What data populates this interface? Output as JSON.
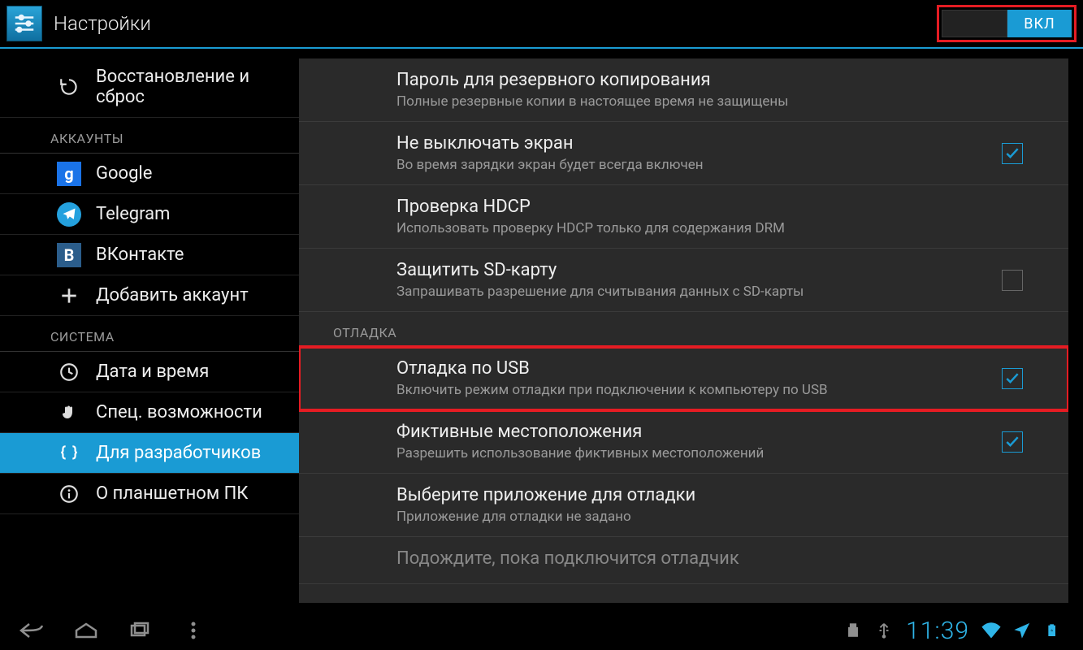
{
  "header": {
    "title": "Настройки",
    "switch_on_label": "ВКЛ"
  },
  "sidebar": {
    "items": [
      {
        "kind": "item",
        "icon": "restore",
        "label": "Восстановление и сброс"
      },
      {
        "kind": "header",
        "label": "АККАУНТЫ"
      },
      {
        "kind": "item",
        "icon": "google",
        "label": "Google"
      },
      {
        "kind": "item",
        "icon": "telegram",
        "label": "Telegram"
      },
      {
        "kind": "item",
        "icon": "vk",
        "label": "ВКонтакте"
      },
      {
        "kind": "item",
        "icon": "plus",
        "label": "Добавить аккаунт"
      },
      {
        "kind": "header",
        "label": "СИСТЕМА"
      },
      {
        "kind": "item",
        "icon": "clock",
        "label": "Дата и время"
      },
      {
        "kind": "item",
        "icon": "hand",
        "label": "Спец. возможности"
      },
      {
        "kind": "item",
        "icon": "braces",
        "label": "Для разработчиков",
        "selected": true
      },
      {
        "kind": "item",
        "icon": "info",
        "label": "О планшетном ПК"
      }
    ]
  },
  "content": {
    "rows": [
      {
        "title": "Пароль для резервного копирования",
        "sub": "Полные резервные копии в настоящее время не защищены"
      },
      {
        "title": "Не выключать экран",
        "sub": "Во время зарядки экран будет всегда включен",
        "checkbox": true,
        "checked": true
      },
      {
        "title": "Проверка HDCP",
        "sub": "Использовать проверку HDCP только для содержания DRM"
      },
      {
        "title": "Защитить SD-карту",
        "sub": "Запрашивать разрешение для считывания данных с SD-карты",
        "checkbox": true,
        "checked": false
      }
    ],
    "section_header": "ОТЛАДКА",
    "rows2": [
      {
        "title": "Отладка по USB",
        "sub": "Включить режим отладки при подключении к компьютеру по USB",
        "checkbox": true,
        "checked": true,
        "highlight": true
      },
      {
        "title": "Фиктивные местоположения",
        "sub": "Разрешить использование фиктивных местоположений",
        "checkbox": true,
        "checked": true
      },
      {
        "title": "Выберите приложение для отладки",
        "sub": "Приложение для отладки не задано"
      },
      {
        "title": "Подождите, пока подключится отладчик",
        "faded": true
      }
    ]
  },
  "status": {
    "clock": "11:39"
  }
}
